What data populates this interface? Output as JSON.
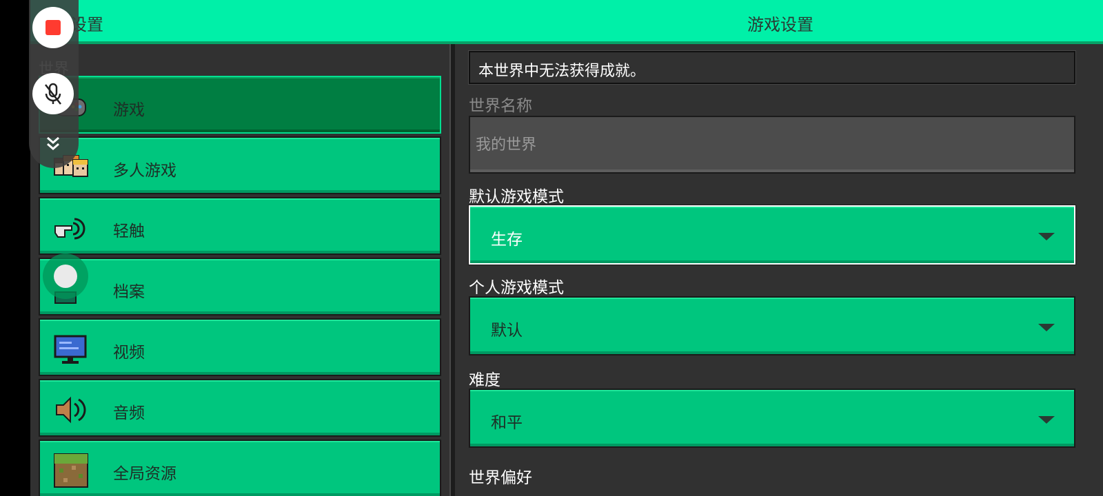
{
  "header": {
    "left_title": "设置",
    "title": "游戏设置"
  },
  "sidebar": {
    "section_label": "世界",
    "items": [
      {
        "label": "游戏",
        "icon": "gamepad-icon",
        "selected": true
      },
      {
        "label": "多人游戏",
        "icon": "multiplayer-faces-icon"
      },
      {
        "label": "轻触",
        "icon": "touch-hand-icon"
      },
      {
        "label": "档案",
        "icon": "profile-icon"
      },
      {
        "label": "视频",
        "icon": "monitor-icon"
      },
      {
        "label": "音频",
        "icon": "speaker-icon"
      },
      {
        "label": "全局资源",
        "icon": "grass-block-icon"
      }
    ]
  },
  "content": {
    "notice": "本世界中无法获得成就。",
    "world_name": {
      "label": "世界名称",
      "placeholder": "我的世界"
    },
    "default_game_mode": {
      "label": "默认游戏模式",
      "value": "生存"
    },
    "personal_game_mode": {
      "label": "个人游戏模式",
      "value": "默认"
    },
    "difficulty": {
      "label": "难度",
      "value": "和平"
    },
    "world_preferences": {
      "label": "世界偏好"
    }
  },
  "overlay": {
    "record_icon": "record-stop-icon",
    "mic_icon": "mic-muted-icon",
    "collapse_icon": "double-chevron-down-icon"
  }
}
